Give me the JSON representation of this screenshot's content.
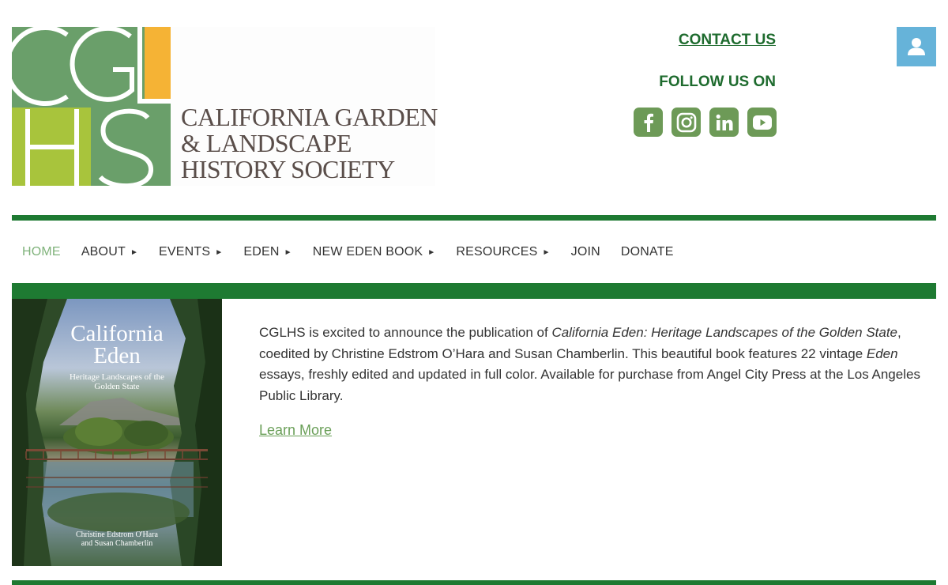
{
  "logo": {
    "letters": [
      "C",
      "G",
      "L",
      "H",
      "S"
    ],
    "name_lines": [
      "CALIFORNIA GARDEN",
      "& LANDSCAPE",
      "HISTORY SOCIETY"
    ],
    "colors": {
      "green": "#6a9f6a",
      "orange": "#f5b335",
      "lime": "#a8c43c"
    }
  },
  "header": {
    "contact_label": "CONTACT US",
    "follow_label": "FOLLOW US ON",
    "social_icons": [
      "facebook-icon",
      "instagram-icon",
      "linkedin-icon",
      "youtube-icon"
    ],
    "account_icon": "user-icon"
  },
  "nav": {
    "items": [
      {
        "label": "HOME",
        "active": true,
        "submenu": false
      },
      {
        "label": "ABOUT",
        "active": false,
        "submenu": true
      },
      {
        "label": "EVENTS",
        "active": false,
        "submenu": true
      },
      {
        "label": "EDEN",
        "active": false,
        "submenu": true
      },
      {
        "label": "NEW EDEN BOOK",
        "active": false,
        "submenu": true
      },
      {
        "label": "RESOURCES",
        "active": false,
        "submenu": true
      },
      {
        "label": "JOIN",
        "active": false,
        "submenu": false
      },
      {
        "label": "DONATE",
        "active": false,
        "submenu": false
      }
    ],
    "submenu_arrow": "►"
  },
  "book_cover": {
    "title_line1": "California",
    "title_line2": "Eden",
    "subtitle_line1": "Heritage Landscapes of the",
    "subtitle_line2": "Golden State",
    "author_line1": "Christine Edstrom O'Hara",
    "author_line2": "and Susan Chamberlin"
  },
  "announcement": {
    "text_1": "CGLHS is excited to announce the publication of ",
    "book_title": "California Eden: Heritage Landscapes of the Golden State",
    "text_2": ", coedited by Christine Edstrom O’Hara and Susan Chamberlin. This beautiful book features 22 vintage ",
    "eden": "Eden",
    "text_3": " essays, freshly edited and updated in full color. Available for purchase from Angel City Press at the Los Angeles Public Library.",
    "link_label": "Learn More"
  },
  "colors": {
    "brand_green": "#1e7a32",
    "link_green": "#1e6b2e",
    "active_nav": "#7fb27a",
    "social_bg": "#6d9a57",
    "account_bg": "#66b3d9"
  }
}
